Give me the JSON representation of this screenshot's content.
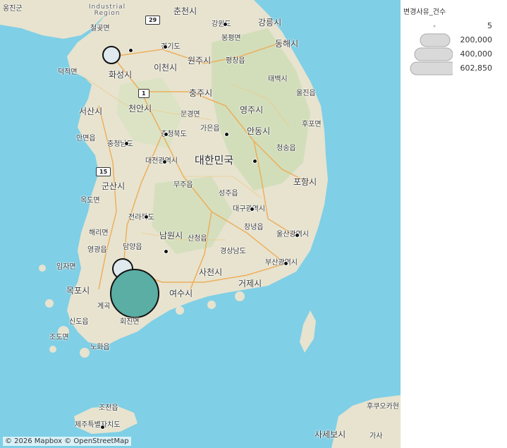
{
  "legend": {
    "title": "변경사유_건수",
    "items": [
      {
        "label": "5"
      },
      {
        "label": "200,000"
      },
      {
        "label": "400,000"
      },
      {
        "label": "602,850"
      }
    ]
  },
  "attribution": "© 2026 Mapbox © OpenStreetMap",
  "country_label": "대한민국",
  "region_label": "Industrial Region",
  "map_labels": [
    {
      "name": "label-ongjin",
      "text": "옹진군",
      "size": "s"
    },
    {
      "name": "label-chuncheon",
      "text": "춘천시",
      "size": "m"
    },
    {
      "name": "label-gangneung",
      "text": "강릉시",
      "size": "m"
    },
    {
      "name": "label-cheolwon",
      "text": "철곶면",
      "size": "s"
    },
    {
      "name": "label-gangwon",
      "text": "강원도",
      "size": "s"
    },
    {
      "name": "label-bongpyeong",
      "text": "봉평면",
      "size": "s"
    },
    {
      "name": "label-donghae",
      "text": "동해시",
      "size": "m"
    },
    {
      "name": "label-gyeonggi",
      "text": "경기도",
      "size": "s"
    },
    {
      "name": "label-wonju",
      "text": "원주시",
      "size": "m"
    },
    {
      "name": "label-pyeongchang",
      "text": "평창읍",
      "size": "s"
    },
    {
      "name": "label-deokjeok",
      "text": "덕적면",
      "size": "s"
    },
    {
      "name": "label-hwaseong",
      "text": "화성시",
      "size": "m"
    },
    {
      "name": "label-icheon",
      "text": "이천시",
      "size": "m"
    },
    {
      "name": "label-taebaek",
      "text": "태백시",
      "size": "s"
    },
    {
      "name": "label-chungju",
      "text": "충주시",
      "size": "m"
    },
    {
      "name": "label-uljin",
      "text": "울진읍",
      "size": "s"
    },
    {
      "name": "label-seosan",
      "text": "서산시",
      "size": "m"
    },
    {
      "name": "label-cheonan",
      "text": "천안시",
      "size": "m"
    },
    {
      "name": "label-mungyeong",
      "text": "문경면",
      "size": "s"
    },
    {
      "name": "label-yeongju",
      "text": "영주시",
      "size": "m"
    },
    {
      "name": "label-hupo",
      "text": "후포면",
      "size": "s"
    },
    {
      "name": "label-chungbuk",
      "text": "충청북도",
      "size": "s"
    },
    {
      "name": "label-gaeun",
      "text": "가은읍",
      "size": "s"
    },
    {
      "name": "label-andong",
      "text": "안동시",
      "size": "m"
    },
    {
      "name": "label-anmyeon",
      "text": "안면읍",
      "size": "s"
    },
    {
      "name": "label-chungnam",
      "text": "충청남도",
      "size": "s"
    },
    {
      "name": "label-cheongsong",
      "text": "청송읍",
      "size": "s"
    },
    {
      "name": "label-daejeon",
      "text": "대전광역시",
      "size": "s"
    },
    {
      "name": "label-gunsan",
      "text": "군산시",
      "size": "m"
    },
    {
      "name": "label-muju",
      "text": "무주읍",
      "size": "s"
    },
    {
      "name": "label-pohang",
      "text": "포항시",
      "size": "m"
    },
    {
      "name": "label-okdo",
      "text": "옥도면",
      "size": "s"
    },
    {
      "name": "label-seongju",
      "text": "성주읍",
      "size": "s"
    },
    {
      "name": "label-daegu",
      "text": "대구광역시",
      "size": "s"
    },
    {
      "name": "label-jeonbuk",
      "text": "전라북도",
      "size": "s"
    },
    {
      "name": "label-hae",
      "text": "해리면",
      "size": "s"
    },
    {
      "name": "label-namwon",
      "text": "남원시",
      "size": "m"
    },
    {
      "name": "label-changnyeong",
      "text": "창녕읍",
      "size": "s"
    },
    {
      "name": "label-ulsan",
      "text": "울산광역시",
      "size": "s"
    },
    {
      "name": "label-sancheong",
      "text": "산청읍",
      "size": "s"
    },
    {
      "name": "label-yeonggwang",
      "text": "영광읍",
      "size": "s"
    },
    {
      "name": "label-damyang",
      "text": "담양읍",
      "size": "s"
    },
    {
      "name": "label-gyeongnam",
      "text": "경상남도",
      "size": "s"
    },
    {
      "name": "label-imja",
      "text": "임자면",
      "size": "s"
    },
    {
      "name": "label-busan",
      "text": "부산광역시",
      "size": "s"
    },
    {
      "name": "label-sacheon",
      "text": "사천시",
      "size": "m"
    },
    {
      "name": "label-geoje",
      "text": "거제시",
      "size": "m"
    },
    {
      "name": "label-mokpo",
      "text": "목포시",
      "size": "m"
    },
    {
      "name": "label-yeosu",
      "text": "여수시",
      "size": "m"
    },
    {
      "name": "label-gyegok",
      "text": "계곡",
      "size": "s"
    },
    {
      "name": "label-sindo",
      "text": "신도읍",
      "size": "s"
    },
    {
      "name": "label-hoejin",
      "text": "회진면",
      "size": "s"
    },
    {
      "name": "label-jodo",
      "text": "조도면",
      "size": "s"
    },
    {
      "name": "label-nohwa",
      "text": "노화읍",
      "size": "s"
    },
    {
      "name": "label-jocheon",
      "text": "조천읍",
      "size": "s"
    },
    {
      "name": "label-jeju",
      "text": "제주특별자치도",
      "size": "s"
    },
    {
      "name": "label-sasebo",
      "text": "사세보시",
      "size": "m"
    },
    {
      "name": "label-gasa",
      "text": "가사",
      "size": "s"
    },
    {
      "name": "label-fukuoka",
      "text": "후쿠오카현",
      "size": "s"
    }
  ],
  "shields": [
    {
      "name": "route-29-shield",
      "text": "29"
    },
    {
      "name": "route-1-shield",
      "text": "1"
    },
    {
      "name": "route-15-shield",
      "text": "15"
    }
  ],
  "bubbles": [
    {
      "name": "bubble-incheon",
      "color": "#dfe9ee",
      "value_fraction": 0.02
    },
    {
      "name": "bubble-gwangju",
      "color": "#dfe9ee",
      "value_fraction": 0.03
    },
    {
      "name": "bubble-jeonnam",
      "color": "#5aaea4",
      "value_fraction": 1.0
    }
  ]
}
